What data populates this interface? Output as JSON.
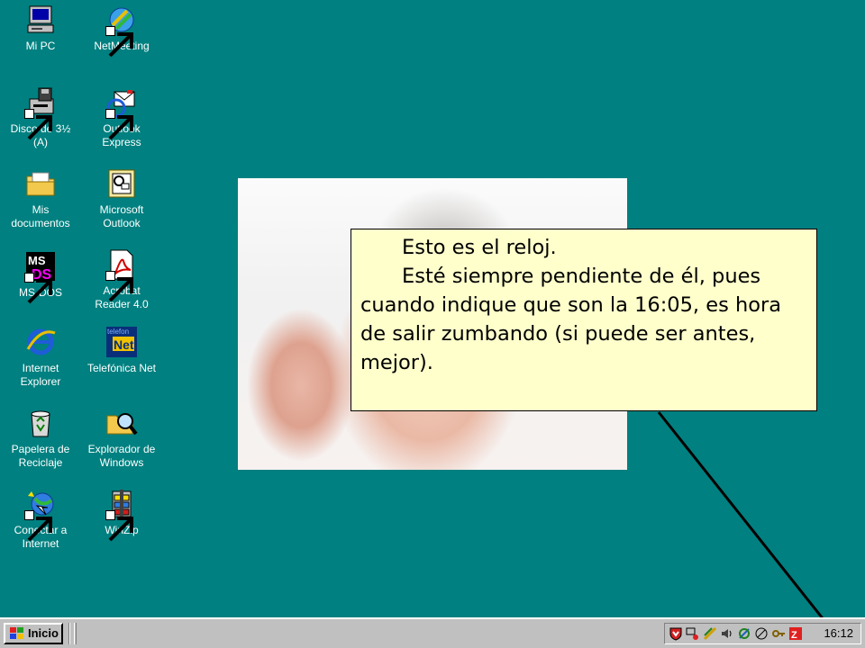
{
  "desktop": {
    "icons": [
      {
        "label": "Mi PC",
        "icon": "computer-icon"
      },
      {
        "label": "NetMeeting",
        "icon": "netmeeting-icon"
      },
      {
        "label": "Disco de 3½\n(A)",
        "icon": "floppy-drive-icon"
      },
      {
        "label": "Outlook\nExpress",
        "icon": "outlook-express-icon"
      },
      {
        "label": "Mis\ndocumentos",
        "icon": "folder-icon"
      },
      {
        "label": "Microsoft\nOutlook",
        "icon": "outlook-icon"
      },
      {
        "label": "MS-DOS",
        "icon": "msdos-icon"
      },
      {
        "label": "Acrobat\nReader 4.0",
        "icon": "acrobat-icon"
      },
      {
        "label": "Internet\nExplorer",
        "icon": "internet-explorer-icon"
      },
      {
        "label": "Telefónica Net",
        "icon": "telefonica-net-icon"
      },
      {
        "label": "Papelera de\nReciclaje",
        "icon": "recycle-bin-icon"
      },
      {
        "label": "Explorador de\nWindows",
        "icon": "windows-explorer-icon"
      },
      {
        "label": "Conectar a\nInternet",
        "icon": "connect-internet-icon"
      },
      {
        "label": "WinZip",
        "icon": "winzip-icon"
      }
    ],
    "background_color": "#008080"
  },
  "callout": {
    "line1": "Esto es el reloj.",
    "line2": "Esté siempre pendiente de él, pues cuando indique que son la 16:05, es hora de salir zumbando (si puede ser antes, mejor).",
    "background_color": "#ffffcc"
  },
  "taskbar": {
    "start_label": "Inicio",
    "clock": "16:12",
    "tray_icons": [
      "antivirus-shield-icon",
      "network-icon",
      "scheduler-icon",
      "volume-icon",
      "power-icon",
      "connection-icon",
      "key-icon",
      "winzip-tray-icon"
    ]
  },
  "telefonica_icon_text": "Net",
  "telefonica_icon_subtext": "telefon"
}
